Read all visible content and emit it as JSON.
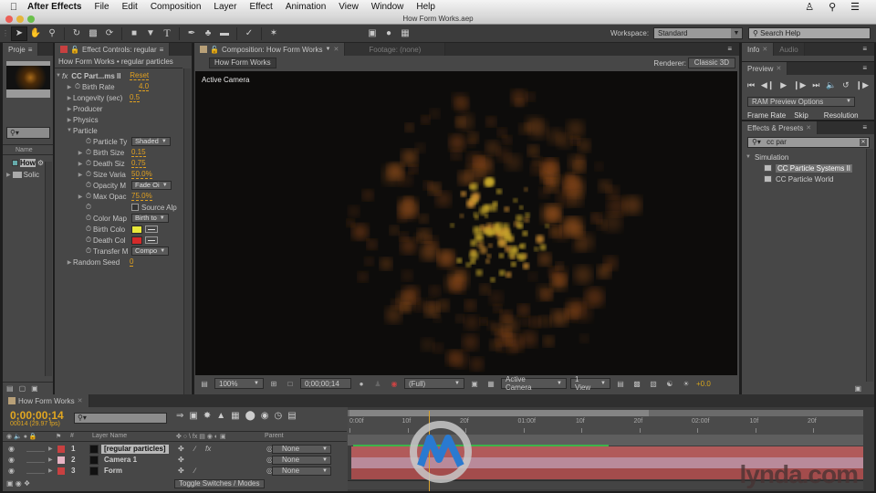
{
  "menubar": {
    "app_name": "After Effects",
    "items": [
      "File",
      "Edit",
      "Composition",
      "Layer",
      "Effect",
      "Animation",
      "View",
      "Window",
      "Help"
    ],
    "right_icons": [
      "user-icon",
      "spotlight-search-icon",
      "menu-list-icon"
    ]
  },
  "window": {
    "title": "How Form Works.aep"
  },
  "toolbar": {
    "tools": [
      "selection-tool",
      "hand-tool",
      "zoom-tool",
      "rotation-tool",
      "camera-tool",
      "pan-behind-tool",
      "rectangle-tool",
      "pen-tool",
      "type-tool",
      "brush-tool",
      "clone-stamp-tool",
      "eraser-tool",
      "roto-brush-tool",
      "puppet-pin-tool"
    ],
    "workspace_label": "Workspace:",
    "workspace_value": "Standard",
    "search_help_placeholder": "Search Help"
  },
  "project_panel": {
    "tab_label": "Proje",
    "search_value": "",
    "column_name": "Name",
    "items": [
      {
        "label": "How",
        "type": "composition",
        "selected": true
      },
      {
        "label": "Solic",
        "type": "folder",
        "selected": false
      }
    ]
  },
  "effect_controls": {
    "tab_label": "Effect Controls: regular",
    "title": "How Form Works • regular particles",
    "effect_name": "CC Part...ms II",
    "reset_label": "Reset",
    "properties": [
      {
        "name": "Birth Rate",
        "value": "4.0",
        "indent": 1,
        "twirl": true,
        "stopwatch": true
      },
      {
        "name": "Longevity (sec)",
        "value": "0.5",
        "indent": 1,
        "twirl": true,
        "stopwatch": false
      },
      {
        "name": "Producer",
        "indent": 1,
        "twirl": true,
        "group": true
      },
      {
        "name": "Physics",
        "indent": 1,
        "twirl": true,
        "group": true
      },
      {
        "name": "Particle",
        "indent": 1,
        "twirl": true,
        "group": true,
        "open": true
      },
      {
        "name": "Particle Ty",
        "dropdown": "Shaded",
        "indent": 2
      },
      {
        "name": "Birth Size",
        "value": "0.15",
        "indent": 2,
        "twirl": true
      },
      {
        "name": "Death Siz",
        "value": "0.75",
        "indent": 2,
        "twirl": true
      },
      {
        "name": "Size Varia",
        "value": "50.0%",
        "indent": 2,
        "twirl": true
      },
      {
        "name": "Opacity M",
        "dropdown": "Fade Oi",
        "indent": 2
      },
      {
        "name": "Max Opac",
        "value": "75.0%",
        "indent": 2,
        "twirl": true
      },
      {
        "name": "",
        "checkbox": "Source Alp",
        "indent": 2
      },
      {
        "name": "Color Map",
        "dropdown": "Birth to",
        "indent": 2
      },
      {
        "name": "Birth Colo",
        "color": "#e8e83a",
        "indent": 2
      },
      {
        "name": "Death Col",
        "color": "#d42a2a",
        "indent": 2
      },
      {
        "name": "Transfer M",
        "dropdown": "Compo",
        "indent": 2
      },
      {
        "name": "Random Seed",
        "value": "0",
        "indent": 1,
        "twirl": true,
        "stopwatch": false
      }
    ]
  },
  "composition": {
    "tab_label": "Composition: How Form Works",
    "footage_tab": "Footage: (none)",
    "breadcrumb": "How Form Works",
    "renderer_label": "Renderer:",
    "renderer_value": "Classic 3D",
    "view_label": "Active Camera",
    "footer": {
      "magnification": "100%",
      "timecode": "0;00;00;14",
      "resolution": "(Full)",
      "camera": "Active Camera",
      "views": "1 View",
      "exposure": "+0.0"
    }
  },
  "info_panel": {
    "tabs": [
      "Info",
      "Audio"
    ]
  },
  "preview_panel": {
    "tab_label": "Preview",
    "controls": [
      "first-frame",
      "prev-frame",
      "play",
      "next-frame",
      "last-frame",
      "audio",
      "loop",
      "ram-preview"
    ],
    "ram_options": "RAM Preview Options",
    "labels": [
      "Frame Rate",
      "Skip",
      "Resolution"
    ]
  },
  "effects_presets": {
    "tab_label": "Effects & Presets",
    "search_value": "cc par",
    "category": "Simulation",
    "items": [
      {
        "label": "CC Particle Systems II",
        "selected": true
      },
      {
        "label": "CC Particle World",
        "selected": false
      }
    ]
  },
  "timeline": {
    "tab_label": "How Form Works",
    "timecode": "0;00;00;14",
    "frame_info": "00014 (29.97 fps)",
    "columns": {
      "layer_name": "Layer Name",
      "parent": "Parent",
      "number": "#"
    },
    "layers": [
      {
        "num": "1",
        "name": "[regular particles]",
        "label_color": "#c84040",
        "selected": true,
        "parent": "None",
        "fx": true
      },
      {
        "num": "2",
        "name": "Camera 1",
        "label_color": "#e6b4c4",
        "selected": false,
        "parent": "None",
        "fx": false
      },
      {
        "num": "3",
        "name": "Form",
        "label_color": "#c84040",
        "selected": false,
        "parent": "None",
        "fx": false
      }
    ],
    "toggle_label": "Toggle Switches / Modes",
    "ruler_labels": [
      "0:00f",
      "10f",
      "20f",
      "01:00f",
      "10f",
      "20f",
      "02:00f",
      "10f",
      "20f"
    ],
    "current_frame": 14
  },
  "watermark": {
    "text": "lynda.com"
  },
  "colors": {
    "accent_timecode": "#e2a720",
    "track_red": "#b15a5a",
    "track_pink": "#b98a9a",
    "work_bar_green": "#3db34a"
  }
}
